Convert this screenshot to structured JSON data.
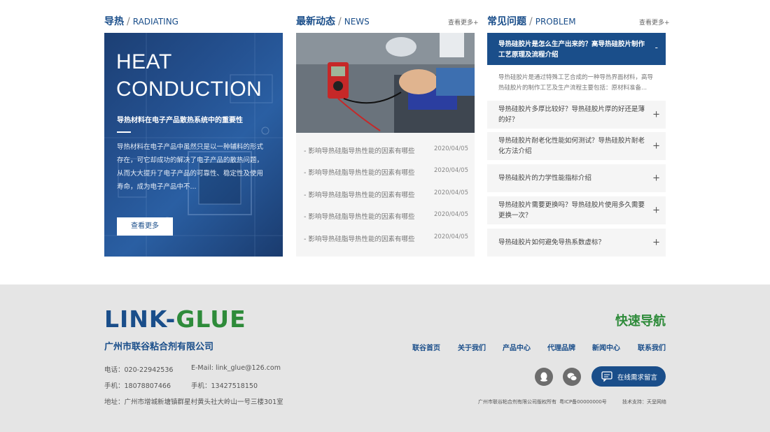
{
  "radiating": {
    "title_cn": "导热",
    "title_en": "RADIATING",
    "heading_line1": "HEAT",
    "heading_line2": "CONDUCTION",
    "subtitle": "导热材料在电子产品散热系统中的重要性",
    "description": "导热材料在电子产品中虽然只是以一种辅料的形式存在，可它却成功的解决了电子产品的散热问题，从而大大提升了电子产品的可靠性、稳定性及使用寿命，成为电子产品中不...",
    "button": "查看更多"
  },
  "news": {
    "title_cn": "最新动态",
    "title_en": "NEWS",
    "more": "查看更多+",
    "items": [
      {
        "title": "- 影响导热硅脂导热性能的因素有哪些",
        "date": "2020/04/05"
      },
      {
        "title": "- 影响导热硅脂导热性能的因素有哪些",
        "date": "2020/04/05"
      },
      {
        "title": "- 影响导热硅脂导热性能的因素有哪些",
        "date": "2020/04/05"
      },
      {
        "title": "- 影响导热硅脂导热性能的因素有哪些",
        "date": "2020/04/05"
      },
      {
        "title": "- 影响导热硅脂导热性能的因素有哪些",
        "date": "2020/04/05"
      }
    ]
  },
  "problem": {
    "title_cn": "常见问题",
    "title_en": "PROBLEM",
    "more": "查看更多+",
    "open_question": "导热硅胶片是怎么生产出来的？高导热硅胶片制作工艺原理及流程介绍",
    "open_sign": "-",
    "open_answer": "导热硅胶片是通过特殊工艺合成的一种导热界面材料，高导热硅胶片的制作工艺及生产流程主要包括：原材料准备...",
    "items": [
      {
        "question": "导热硅胶片多厚比较好？导热硅胶片厚的好还是薄的好？",
        "sign": "+"
      },
      {
        "question": "导热硅胶片耐老化性能如何测试？导热硅胶片耐老化方法介绍",
        "sign": "+"
      },
      {
        "question": "导热硅胶片的力学性能指标介绍",
        "sign": "+"
      },
      {
        "question": "导热硅胶片需要更换吗？导热硅胶片使用多久需要更换一次？",
        "sign": "+"
      },
      {
        "question": "导热硅胶片如何避免导热系数虚标？",
        "sign": "+"
      }
    ]
  },
  "footer": {
    "logo_part1": "LINK-",
    "logo_part2": "GLUE",
    "company": "广州市联谷粘合剂有限公司",
    "phone": "电话：020-22942536",
    "email": "E-Mail: link_glue@126.com",
    "mobile1": "手机：18078807466",
    "mobile2": "手机：13427518150",
    "address": "地址：广州市增城新塘镇群星村黄头社大岭山一号三楼301室",
    "quick_nav_title": "快速导航",
    "nav": [
      "联谷首页",
      "关于我们",
      "产品中心",
      "代理品牌",
      "新闻中心",
      "联系我们"
    ],
    "online_button": "在线需求留言",
    "copyright": "广州市联谷粘合剂有限公司版权所有",
    "icp": "粤ICP备00000000号",
    "support": "技术支持：天呈网络"
  },
  "colors": {
    "brand_blue": "#1a4e8a",
    "brand_green": "#2e8b3a",
    "footer_bg": "#e5e5e5"
  }
}
